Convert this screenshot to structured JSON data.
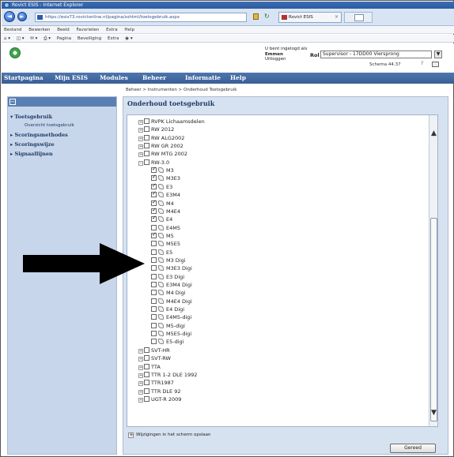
{
  "browser": {
    "window_title": "Rovict ESIS - Internet Explorer",
    "url": "https://esis73.rovictonline.nl/pagina/sshtml/toetsgebruik.aspx",
    "tab_label": "Rovict ESIS",
    "menu": [
      "Bestand",
      "Bewerken",
      "Beeld",
      "Favorieten",
      "Extra",
      "Help"
    ],
    "command": [
      "Pagina",
      "Beveiliging",
      "Extra"
    ]
  },
  "header": {
    "login_label": "U bent ingelogd als",
    "login_user": "Emmen",
    "logout_label": "Uitloggen",
    "rol_label": "Rol",
    "rol_value": "Supervisor - 17DD00 Viersprong",
    "schema": "Schema 44.37",
    "help": "?"
  },
  "nav": [
    "Startpagina",
    "Mijn ESIS",
    "Modules",
    "Beheer",
    "Informatie",
    "Help"
  ],
  "breadcrumb": "Beheer > Instrumenten > Onderhoud Toetsgebruik",
  "sidebar": {
    "items": [
      {
        "label": "Toetsgebruik",
        "prefix": "▾"
      },
      {
        "label": "Overzicht toetsgebruik",
        "sub": true
      },
      {
        "label": "Scoringsmethodes",
        "prefix": "▸"
      },
      {
        "label": "Scoringswijze",
        "prefix": "▸"
      },
      {
        "label": "Signaallijnen",
        "prefix": "▸"
      }
    ]
  },
  "main": {
    "title": "Onderhoud toetsgebruik",
    "tree": [
      {
        "label": "RVPK Lichaamsdelen",
        "level": 0,
        "expand": "+",
        "checked": false
      },
      {
        "label": "RW 2012",
        "level": 0,
        "expand": "+",
        "checked": false
      },
      {
        "label": "RW ALG2002",
        "level": 0,
        "expand": "+",
        "checked": false
      },
      {
        "label": "RW GR 2002",
        "level": 0,
        "expand": "+",
        "checked": false
      },
      {
        "label": "RW MTG 2002",
        "level": 0,
        "expand": "+",
        "checked": false
      },
      {
        "label": "RW-3.0",
        "level": 0,
        "expand": "−",
        "checked": false
      },
      {
        "label": "M3",
        "level": 1,
        "checked": true
      },
      {
        "label": "M3E3",
        "level": 1,
        "checked": true
      },
      {
        "label": "E3",
        "level": 1,
        "checked": true
      },
      {
        "label": "E3M4",
        "level": 1,
        "checked": true
      },
      {
        "label": "M4",
        "level": 1,
        "checked": true
      },
      {
        "label": "M4E4",
        "level": 1,
        "checked": true
      },
      {
        "label": "E4",
        "level": 1,
        "checked": true
      },
      {
        "label": "E4M5",
        "level": 1,
        "checked": false
      },
      {
        "label": "M5",
        "level": 1,
        "checked": true
      },
      {
        "label": "M5E5",
        "level": 1,
        "checked": false
      },
      {
        "label": "E5",
        "level": 1,
        "checked": false
      },
      {
        "label": "M3 Digi",
        "level": 1,
        "checked": false
      },
      {
        "label": "M3E3 Digi",
        "level": 1,
        "checked": false
      },
      {
        "label": "E3 Digi",
        "level": 1,
        "checked": false
      },
      {
        "label": "E3M4 Digi",
        "level": 1,
        "checked": false
      },
      {
        "label": "M4 Digi",
        "level": 1,
        "checked": false
      },
      {
        "label": "M4E4 Digi",
        "level": 1,
        "checked": false
      },
      {
        "label": "E4 Digi",
        "level": 1,
        "checked": false
      },
      {
        "label": "E4M5-digi",
        "level": 1,
        "checked": false
      },
      {
        "label": "M5-digi",
        "level": 1,
        "checked": false
      },
      {
        "label": "M5E5-digi",
        "level": 1,
        "checked": false
      },
      {
        "label": "E5-digi",
        "level": 1,
        "checked": false
      },
      {
        "label": "SVT-HR",
        "level": 0,
        "expand": "+",
        "checked": false
      },
      {
        "label": "SVT-RW",
        "level": 0,
        "expand": "+",
        "checked": false
      },
      {
        "label": "TTA",
        "level": 0,
        "expand": "+",
        "checked": false
      },
      {
        "label": "TTR 1-2 DLE 1992",
        "level": 0,
        "expand": "+",
        "checked": false
      },
      {
        "label": "TTR1987",
        "level": 0,
        "expand": "+",
        "checked": false
      },
      {
        "label": "TTR DLE 92",
        "level": 0,
        "expand": "+",
        "checked": false
      },
      {
        "label": "UGT-R 2009",
        "level": 0,
        "expand": "+",
        "checked": false
      }
    ],
    "save_label": "Wijzigingen in het scherm opslaan",
    "done_label": "Gereed"
  },
  "colors": {
    "nav_bg": "#4e76ad",
    "sidebar_bg": "#c7d6ea",
    "main_bg": "#d7e2f0",
    "arrow": "#000000"
  }
}
